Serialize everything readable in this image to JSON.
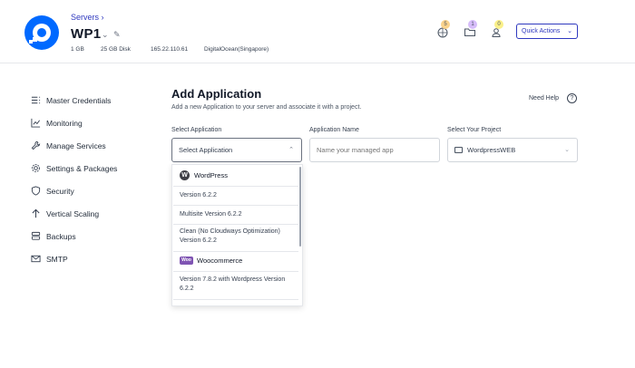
{
  "header": {
    "breadcrumb": "Servers ›",
    "server_name": "WP1",
    "caret": "⌄",
    "edit_icon": "pencil-icon",
    "meta": {
      "ram": "1 GB",
      "disk": "25 GB Disk",
      "ip": "165.22.110.61",
      "provider": "DigitalOcean(Singapore)"
    },
    "icons": [
      {
        "name": "www-icon",
        "badge": "5",
        "badge_color": "#fbd38d"
      },
      {
        "name": "folder-icon",
        "badge": "1",
        "badge_color": "#d6bcfa"
      },
      {
        "name": "user-icon",
        "badge": "0",
        "badge_color": "#faf089"
      }
    ],
    "quick_actions": "Quick Actions",
    "quick_actions_chevron": "⌄"
  },
  "sidebar": {
    "items": [
      {
        "label": "Master Credentials",
        "icon": "list-icon"
      },
      {
        "label": "Monitoring",
        "icon": "chart-icon"
      },
      {
        "label": "Manage Services",
        "icon": "wrench-icon"
      },
      {
        "label": "Settings & Packages",
        "icon": "gear-icon"
      },
      {
        "label": "Security",
        "icon": "shield-icon"
      },
      {
        "label": "Vertical Scaling",
        "icon": "arrow-up-icon"
      },
      {
        "label": "Backups",
        "icon": "database-icon"
      },
      {
        "label": "SMTP",
        "icon": "mail-icon"
      }
    ]
  },
  "main": {
    "title": "Add Application",
    "subtitle": "Add a new Application to your server and associate it with a project.",
    "need_help": "Need Help",
    "help_glyph": "?",
    "fields": {
      "app_label": "Select Application",
      "app_value": "Select Application",
      "name_label": "Application Name",
      "name_placeholder": "Name your managed app",
      "project_label": "Select Your Project",
      "project_value": "WordpressWEB"
    },
    "dropdown": {
      "groups": [
        {
          "header": "WordPress",
          "logo_text": "W",
          "items": [
            "Version 6.2.2",
            "Multisite Version 6.2.2",
            "Clean (No Cloudways Optimization) Version 6.2.2"
          ]
        },
        {
          "header": "Woocommerce",
          "logo_text": "Woo",
          "items": [
            "Version 7.8.2 with Wordpress Version 6.2.2"
          ]
        }
      ]
    }
  },
  "colors": {
    "accent": "#2f39bf",
    "logo_blue": "#0069ff",
    "woo_purple": "#7f54b3"
  }
}
